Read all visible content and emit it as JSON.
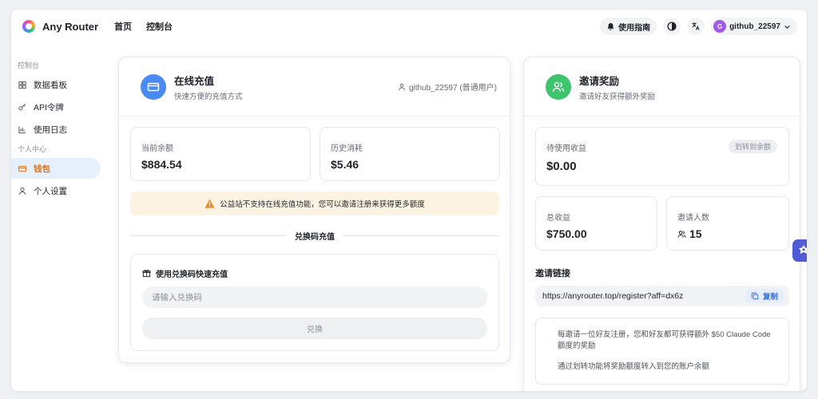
{
  "app": {
    "brand": "Any Router"
  },
  "nav": {
    "home": "首页",
    "console": "控制台"
  },
  "header": {
    "guide": "使用指南",
    "username": "github_22597",
    "avatar_letter": "G"
  },
  "sidebar": {
    "group1": "控制台",
    "items1": [
      {
        "label": "数据看板",
        "icon": "dashboard-icon"
      },
      {
        "label": "API令牌",
        "icon": "key-icon"
      },
      {
        "label": "使用日志",
        "icon": "chart-icon"
      }
    ],
    "group2": "个人中心",
    "items2": [
      {
        "label": "钱包",
        "icon": "wallet-icon",
        "active": true
      },
      {
        "label": "个人设置",
        "icon": "user-icon"
      }
    ]
  },
  "recharge": {
    "title": "在线充值",
    "subtitle": "快速方便的充值方式",
    "user": "github_22597 (普通用户)",
    "balance_label": "当前余额",
    "balance_value": "$884.54",
    "history_label": "历史消耗",
    "history_value": "$5.46",
    "notice": "公益站不支持在线充值功能，您可以邀请注册来获得更多额度",
    "divider": "兑换码充值",
    "redeem_title": "使用兑换码快速充值",
    "redeem_placeholder": "请输入兑换码",
    "redeem_button": "兑换"
  },
  "invite": {
    "title": "邀请奖励",
    "subtitle": "邀请好友获得额外奖励",
    "pending_label": "待使用收益",
    "pending_value": "$0.00",
    "transfer": "划转到余额",
    "total_label": "总收益",
    "total_value": "$750.00",
    "count_label": "邀请人数",
    "count_value": "15",
    "link_title": "邀请链接",
    "link": "https://anyrouter.top/register?aff=dx6z",
    "copy": "复制",
    "info1": "每邀请一位好友注册，您和好友都可获得额外 $50 Claude Code 额度的奖励",
    "info2": "通过划转功能将奖励额度转入到您的账户余额"
  },
  "colors": {
    "accent_blue": "#4a8af4",
    "accent_green": "#3ec46d",
    "active_orange": "#e0701a"
  }
}
